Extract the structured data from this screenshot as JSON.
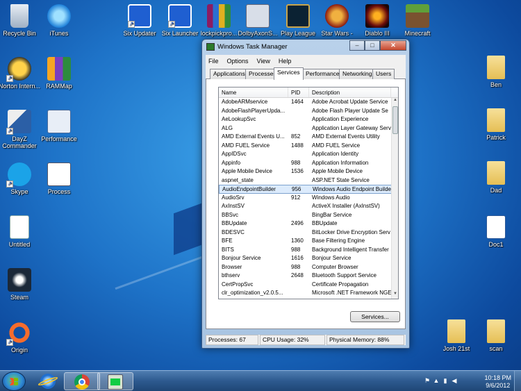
{
  "desktop": {
    "icons_left": [
      {
        "label": "Recycle Bin",
        "icon": "recycle-bin-icon"
      },
      {
        "label": "iTunes",
        "icon": "itunes-icon"
      },
      {
        "label": "Norton Intern...",
        "icon": "norton-icon"
      },
      {
        "label": "RAMMap",
        "icon": "rammap-icon"
      },
      {
        "label": "DayZ Commander",
        "icon": "dayz-icon"
      },
      {
        "label": "Performance",
        "icon": "performance-icon"
      },
      {
        "label": "Skype",
        "icon": "skype-icon"
      },
      {
        "label": "Process",
        "icon": "process-icon"
      },
      {
        "label": "Untitled",
        "icon": "document-icon"
      },
      {
        "label": "Steam",
        "icon": "steam-icon"
      },
      {
        "label": "Origin",
        "icon": "origin-icon"
      }
    ],
    "icons_top": [
      {
        "label": "Six Updater",
        "icon": "six-updater-icon"
      },
      {
        "label": "Six Launcher",
        "icon": "six-launcher-icon"
      },
      {
        "label": "lockpickpro...",
        "icon": "winrar-icon"
      },
      {
        "label": "DolbyAxonS...",
        "icon": "dolby-axon-icon"
      },
      {
        "label": "Play League",
        "icon": "league-icon"
      },
      {
        "label": "Star Wars -",
        "icon": "starwars-icon"
      },
      {
        "label": "Diablo III",
        "icon": "diablo-icon"
      },
      {
        "label": "Minecraft",
        "icon": "minecraft-icon"
      }
    ],
    "icons_right": [
      {
        "label": "Ben",
        "icon": "folder-icon"
      },
      {
        "label": "Patrick",
        "icon": "folder-icon"
      },
      {
        "label": "Dad",
        "icon": "folder-icon"
      },
      {
        "label": "Doc1",
        "icon": "word-doc-icon"
      },
      {
        "label": "Josh 21st",
        "icon": "folder-icon"
      },
      {
        "label": "scan",
        "icon": "folder-icon"
      }
    ]
  },
  "window": {
    "title": "Windows Task Manager",
    "menu": [
      "File",
      "Options",
      "View",
      "Help"
    ],
    "tabs": [
      "Applications",
      "Processes",
      "Services",
      "Performance",
      "Networking",
      "Users"
    ],
    "active_tab": "Services",
    "columns": [
      "Name",
      "PID",
      "Description"
    ],
    "rows": [
      {
        "name": "AdobeARMservice",
        "pid": "1464",
        "desc": "Adobe Acrobat Update Service"
      },
      {
        "name": "AdobeFlashPlayerUpda...",
        "pid": "",
        "desc": "Adobe Flash Player Update Se"
      },
      {
        "name": "AeLookupSvc",
        "pid": "",
        "desc": "Application Experience"
      },
      {
        "name": "ALG",
        "pid": "",
        "desc": "Application Layer Gateway Serv"
      },
      {
        "name": "AMD External Events U...",
        "pid": "852",
        "desc": "AMD External Events Utility"
      },
      {
        "name": "AMD FUEL Service",
        "pid": "1488",
        "desc": "AMD FUEL Service"
      },
      {
        "name": "AppIDSvc",
        "pid": "",
        "desc": "Application Identity"
      },
      {
        "name": "Appinfo",
        "pid": "988",
        "desc": "Application Information"
      },
      {
        "name": "Apple Mobile Device",
        "pid": "1536",
        "desc": "Apple Mobile Device"
      },
      {
        "name": "aspnet_state",
        "pid": "",
        "desc": "ASP.NET State Service"
      },
      {
        "name": "AudioEndpointBuilder",
        "pid": "956",
        "desc": "Windows Audio Endpoint Builder",
        "selected": true
      },
      {
        "name": "AudioSrv",
        "pid": "912",
        "desc": "Windows Audio"
      },
      {
        "name": "AxInstSV",
        "pid": "",
        "desc": "ActiveX Installer (AxInstSV)"
      },
      {
        "name": "BBSvc",
        "pid": "",
        "desc": "BingBar Service"
      },
      {
        "name": "BBUpdate",
        "pid": "2496",
        "desc": "BBUpdate"
      },
      {
        "name": "BDESVC",
        "pid": "",
        "desc": "BitLocker Drive Encryption Serv"
      },
      {
        "name": "BFE",
        "pid": "1360",
        "desc": "Base Filtering Engine"
      },
      {
        "name": "BITS",
        "pid": "988",
        "desc": "Background Intelligent Transfer"
      },
      {
        "name": "Bonjour Service",
        "pid": "1616",
        "desc": "Bonjour Service"
      },
      {
        "name": "Browser",
        "pid": "988",
        "desc": "Computer Browser"
      },
      {
        "name": "bthserv",
        "pid": "2648",
        "desc": "Bluetooth Support Service"
      },
      {
        "name": "CertPropSvc",
        "pid": "",
        "desc": "Certificate Propagation"
      },
      {
        "name": "clr_optimization_v2.0.5...",
        "pid": "",
        "desc": "Microsoft .NET Framework NGE"
      }
    ],
    "services_button": "Services...",
    "status": {
      "processes": "Processes: 67",
      "cpu": "CPU Usage: 32%",
      "memory": "Physical Memory: 88%"
    }
  },
  "taskbar": {
    "time": "10:18 PM",
    "date": "9/6/2012"
  }
}
